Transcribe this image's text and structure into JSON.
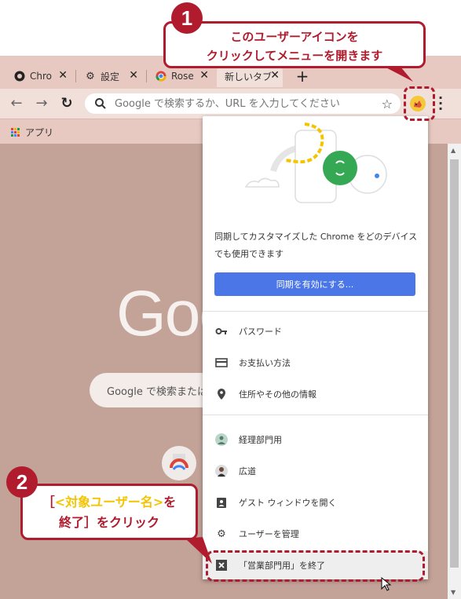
{
  "tabs": [
    {
      "label": "Chro",
      "icon": "chrome-github-icon"
    },
    {
      "label": "設定",
      "icon": "gear-icon"
    },
    {
      "label": "Rose",
      "icon": "chrome-logo-icon"
    },
    {
      "label": "新しいタブ",
      "icon": ""
    }
  ],
  "toolbar": {
    "omnibox_placeholder": "Google で検索するか、URL を入力してください"
  },
  "bookmarks": {
    "apps_label": "アプリ"
  },
  "newtab": {
    "logo": "Goo",
    "search_placeholder": "Google で検索または"
  },
  "profile_menu": {
    "sync_text": "同期してカスタマイズした Chrome をどのデバイスでも使用できます",
    "sync_button": "同期を有効にする...",
    "items": [
      {
        "label": "パスワード",
        "icon": "key-icon"
      },
      {
        "label": "お支払い方法",
        "icon": "credit-card-icon"
      },
      {
        "label": "住所やその他の情報",
        "icon": "location-pin-icon"
      },
      {
        "label": "経理部門用",
        "icon": "profile-avatar-icon"
      },
      {
        "label": "広道",
        "icon": "profile-avatar-icon"
      },
      {
        "label": "ゲスト ウィンドウを開く",
        "icon": "guest-badge-icon"
      },
      {
        "label": "ユーザーを管理",
        "icon": "gear-icon"
      },
      {
        "label": "「営業部門用」を終了",
        "icon": "close-box-icon"
      }
    ]
  },
  "annotations": {
    "step1_number": "1",
    "step1_line1": "このユーザーアイコンを",
    "step1_line2": "クリックしてメニューを開きます",
    "step2_number": "2",
    "step2_open_bracket": "［",
    "step2_highlight": "<対象ユーザー名>",
    "step2_after": "を",
    "step2_line2": "終了］をクリック"
  },
  "colors": {
    "accent_red": "#b01c2e",
    "highlight_yellow": "#f5c400",
    "sync_blue": "#4a76e8",
    "theme_rose": "#c3a298"
  }
}
